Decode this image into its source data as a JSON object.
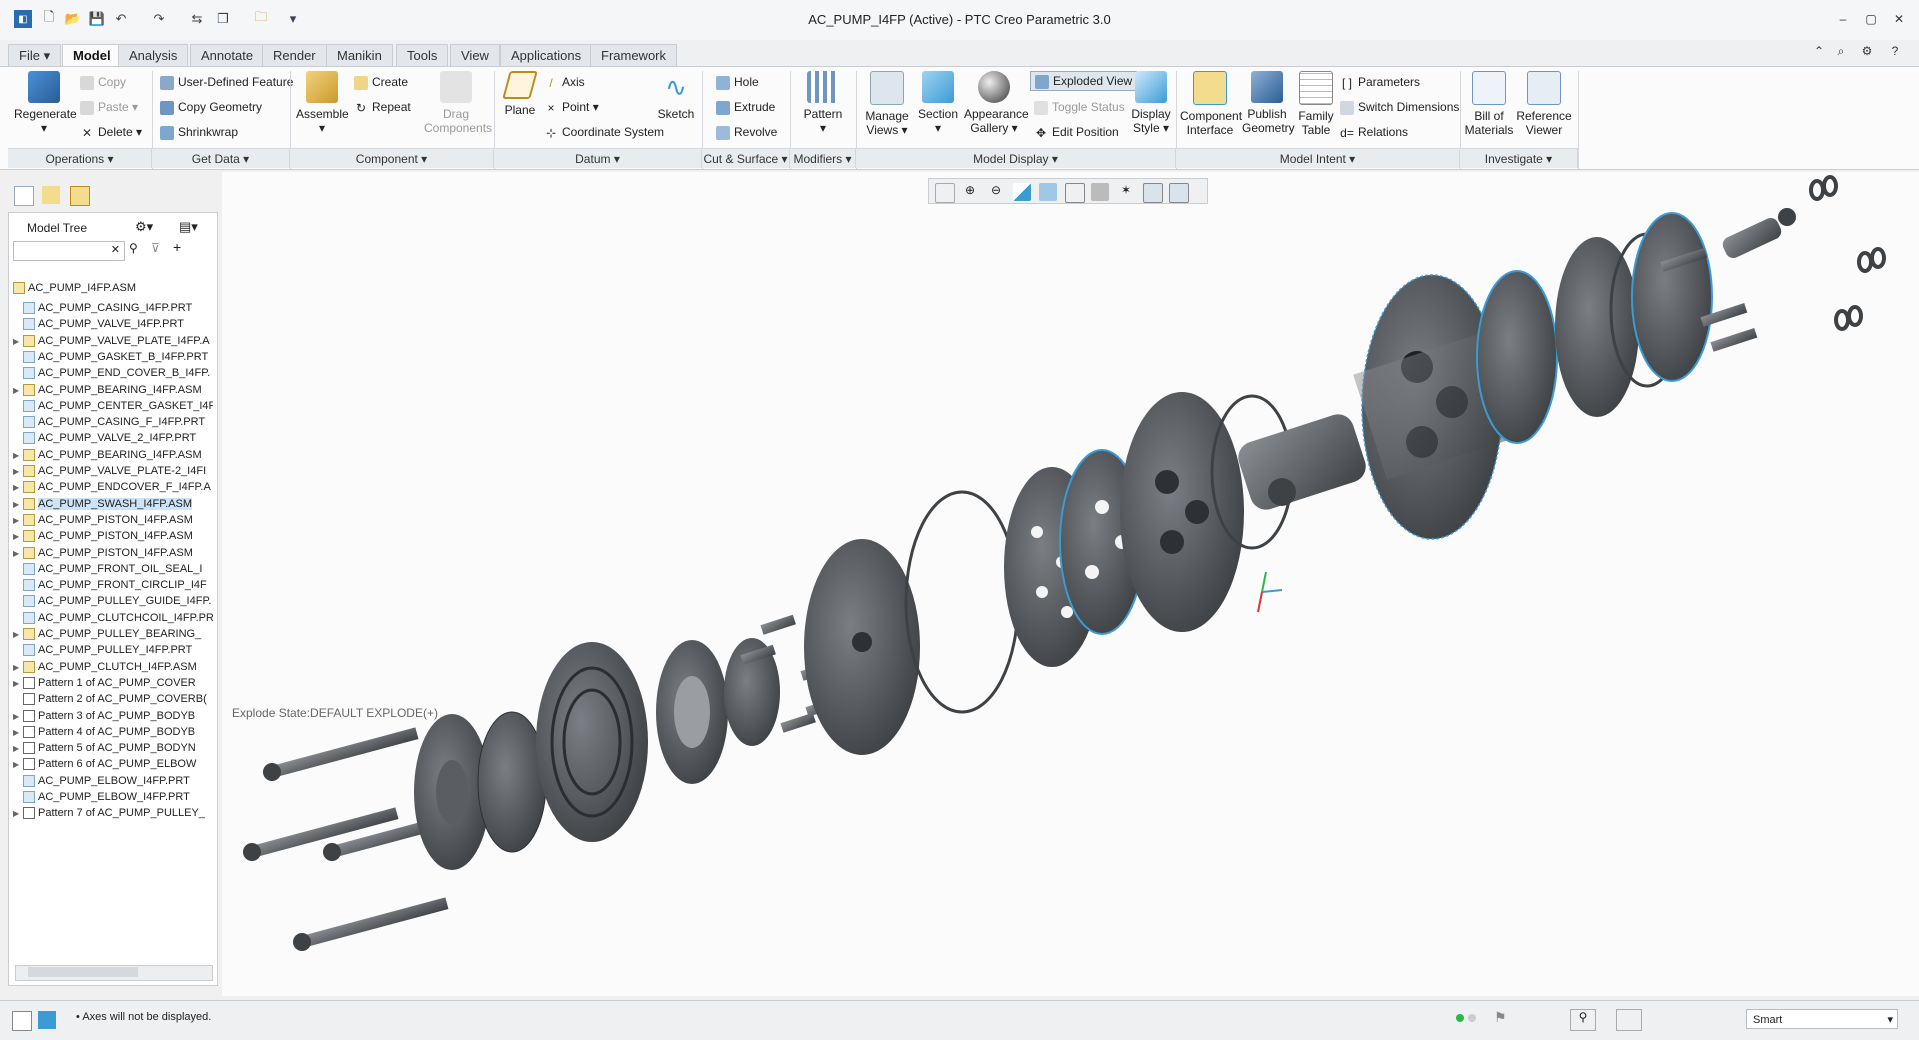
{
  "window": {
    "title": "AC_PUMP_I4FP (Active) - PTC Creo Parametric 3.0",
    "controls": [
      "minimize",
      "maximize",
      "close"
    ]
  },
  "tabs": [
    "File",
    "Model",
    "Analysis",
    "Annotate",
    "Render",
    "Manikin",
    "Tools",
    "View",
    "Applications",
    "Framework"
  ],
  "active_tab": "Model",
  "ribbon": {
    "operations": {
      "regenerate": "Regenerate",
      "copy": "Copy",
      "paste": "Paste",
      "delete": "Delete",
      "group": "Operations"
    },
    "get_data": {
      "udf": "User-Defined Feature",
      "copy_geometry": "Copy Geometry",
      "shrinkwrap": "Shrinkwrap",
      "group": "Get Data"
    },
    "component": {
      "assemble": "Assemble",
      "create": "Create",
      "repeat": "Repeat",
      "drag": "Drag Components",
      "group": "Component"
    },
    "datum": {
      "plane": "Plane",
      "axis": "Axis",
      "point": "Point",
      "csys": "Coordinate System",
      "sketch": "Sketch",
      "group": "Datum"
    },
    "cut_surface": {
      "hole": "Hole",
      "extrude": "Extrude",
      "revolve": "Revolve",
      "group": "Cut & Surface"
    },
    "modifiers": {
      "pattern": "Pattern",
      "group": "Modifiers"
    },
    "model_display": {
      "manage_views": "Manage Views",
      "section": "Section",
      "appearance": "Appearance Gallery",
      "exploded": "Exploded View",
      "toggle": "Toggle Status",
      "edit_position": "Edit Position",
      "display_style": "Display Style",
      "group": "Model Display"
    },
    "model_intent": {
      "component_interface": "Component Interface",
      "publish_geometry": "Publish Geometry",
      "family_table": "Family Table",
      "parameters": "Parameters",
      "switch_dimensions": "Switch Dimensions",
      "relations": "Relations",
      "group": "Model Intent"
    },
    "investigate": {
      "bom": "Bill of Materials",
      "reference_viewer": "Reference Viewer",
      "group": "Investigate"
    }
  },
  "model_tree": {
    "title": "Model Tree",
    "search_placeholder": "",
    "root": "AC_PUMP_I4FP.ASM",
    "items": [
      {
        "label": "AC_PUMP_CASING_I4FP.PRT",
        "type": "prt",
        "expandable": false
      },
      {
        "label": "AC_PUMP_VALVE_I4FP.PRT",
        "type": "prt",
        "expandable": false
      },
      {
        "label": "AC_PUMP_VALVE_PLATE_I4FP.A",
        "type": "asm",
        "expandable": true
      },
      {
        "label": "AC_PUMP_GASKET_B_I4FP.PRT",
        "type": "prt",
        "expandable": false
      },
      {
        "label": "AC_PUMP_END_COVER_B_I4FP.",
        "type": "prt",
        "expandable": false
      },
      {
        "label": "AC_PUMP_BEARING_I4FP.ASM",
        "type": "asm",
        "expandable": true
      },
      {
        "label": "AC_PUMP_CENTER_GASKET_I4F",
        "type": "prt",
        "expandable": false
      },
      {
        "label": "AC_PUMP_CASING_F_I4FP.PRT",
        "type": "prt",
        "expandable": false
      },
      {
        "label": "AC_PUMP_VALVE_2_I4FP.PRT",
        "type": "prt",
        "expandable": false
      },
      {
        "label": "AC_PUMP_BEARING_I4FP.ASM",
        "type": "asm",
        "expandable": true
      },
      {
        "label": "AC_PUMP_VALVE_PLATE-2_I4FI",
        "type": "asm",
        "expandable": true
      },
      {
        "label": "AC_PUMP_ENDCOVER_F_I4FP.A",
        "type": "asm",
        "expandable": true
      },
      {
        "label": "AC_PUMP_SWASH_I4FP.ASM",
        "type": "asm",
        "expandable": true,
        "selected": true
      },
      {
        "label": "AC_PUMP_PISTON_I4FP.ASM",
        "type": "asm",
        "expandable": true
      },
      {
        "label": "AC_PUMP_PISTON_I4FP.ASM",
        "type": "asm",
        "expandable": true
      },
      {
        "label": "AC_PUMP_PISTON_I4FP.ASM",
        "type": "asm",
        "expandable": true
      },
      {
        "label": "AC_PUMP_FRONT_OIL_SEAL_I",
        "type": "prt",
        "expandable": false
      },
      {
        "label": "AC_PUMP_FRONT_CIRCLIP_I4F",
        "type": "prt",
        "expandable": false
      },
      {
        "label": "AC_PUMP_PULLEY_GUIDE_I4FP.",
        "type": "prt",
        "expandable": false
      },
      {
        "label": "AC_PUMP_CLUTCHCOIL_I4FP.PR",
        "type": "prt",
        "expandable": false
      },
      {
        "label": "AC_PUMP_PULLEY_BEARING_",
        "type": "asm",
        "expandable": true
      },
      {
        "label": "AC_PUMP_PULLEY_I4FP.PRT",
        "type": "prt",
        "expandable": false
      },
      {
        "label": "AC_PUMP_CLUTCH_I4FP.ASM",
        "type": "asm",
        "expandable": true
      },
      {
        "label": "Pattern 1 of AC_PUMP_COVER",
        "type": "pat",
        "expandable": true
      },
      {
        "label": "Pattern 2 of AC_PUMP_COVERB(",
        "type": "pat",
        "expandable": false
      },
      {
        "label": "Pattern 3 of AC_PUMP_BODYB",
        "type": "pat",
        "expandable": true
      },
      {
        "label": "Pattern 4 of AC_PUMP_BODYB",
        "type": "pat",
        "expandable": true
      },
      {
        "label": "Pattern 5 of AC_PUMP_BODYN",
        "type": "pat",
        "expandable": true
      },
      {
        "label": "Pattern 6 of AC_PUMP_ELBOW",
        "type": "pat",
        "expandable": true
      },
      {
        "label": "AC_PUMP_ELBOW_I4FP.PRT",
        "type": "prt",
        "expandable": false
      },
      {
        "label": "AC_PUMP_ELBOW_I4FP.PRT",
        "type": "prt",
        "expandable": false
      },
      {
        "label": "Pattern 7 of AC_PUMP_PULLEY_",
        "type": "pat",
        "expandable": true
      }
    ]
  },
  "graphics": {
    "explode_state": "Explode State:DEFAULT EXPLODE(+)",
    "accent": "#3a9bd5",
    "part_color": "#5e6266"
  },
  "status": {
    "message": "Axes will not be displayed.",
    "filter": "Smart"
  }
}
